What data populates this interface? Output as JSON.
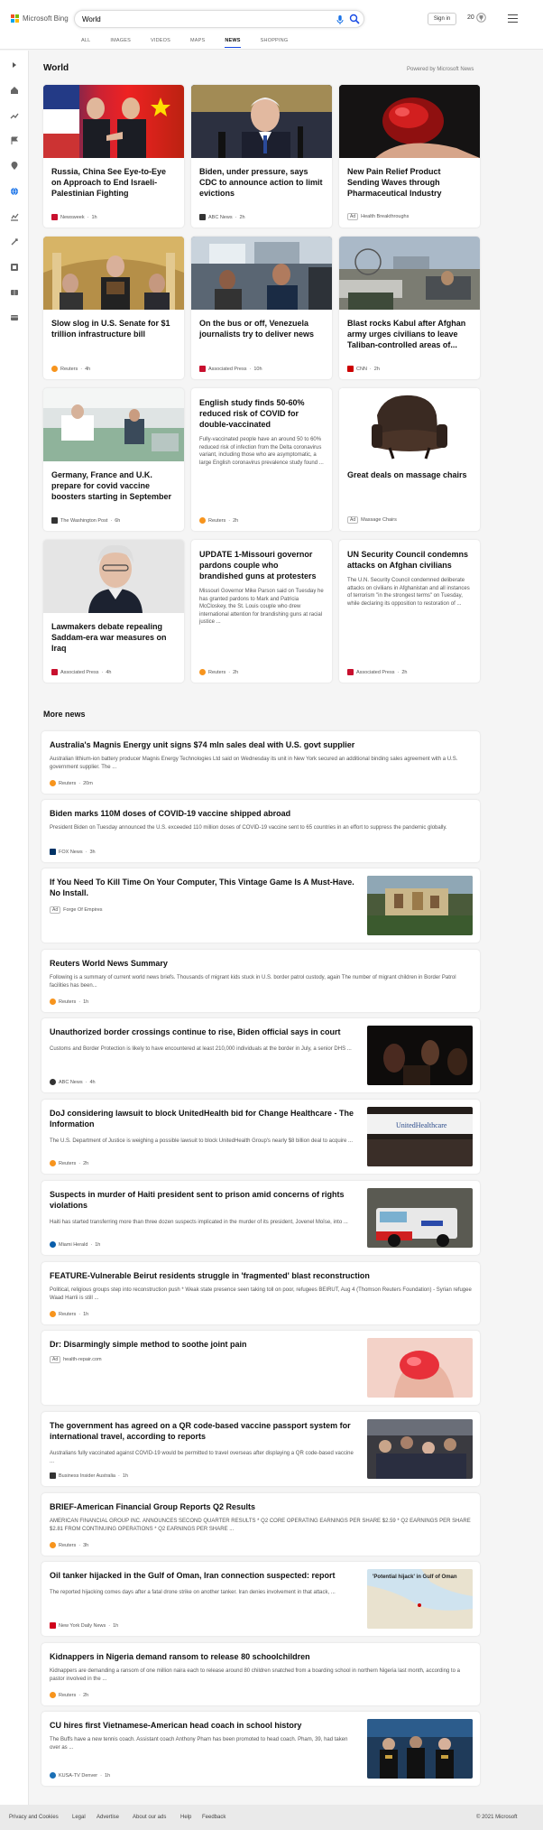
{
  "header": {
    "logo_text": "Microsoft Bing",
    "search_value": "World",
    "signin": "Sign in",
    "rewards_count": "20"
  },
  "nav": [
    "ALL",
    "IMAGES",
    "VIDEOS",
    "MAPS",
    "NEWS",
    "SHOPPING"
  ],
  "section": {
    "title": "World",
    "powered": "Powered by Microsoft News"
  },
  "cards": [
    {
      "title": "Russia, China See Eye-to-Eye on Approach to End Israeli-Palestinian Fighting",
      "source": "Newsweek",
      "time": "1h",
      "color": "#c8102e",
      "ad": false
    },
    {
      "title": "Biden, under pressure, says CDC to announce action to limit evictions",
      "source": "ABC News",
      "time": "2h",
      "color": "#333",
      "ad": false
    },
    {
      "title": "New Pain Relief Product Sending Waves through Pharmaceutical Industry",
      "source": "Health Breakthroughs",
      "time": "",
      "color": "",
      "ad": true
    },
    {
      "title": "Slow slog in U.S. Senate for $1 trillion infrastructure bill",
      "source": "Reuters",
      "time": "4h",
      "color": "#f7941d",
      "ad": false
    },
    {
      "title": "On the bus or off, Venezuela journalists try to deliver news",
      "source": "Associated Press",
      "time": "10h",
      "color": "#c8102e",
      "ad": false
    },
    {
      "title": "Blast rocks Kabul after Afghan army urges civilians to leave Taliban-controlled areas of...",
      "source": "CNN",
      "time": "2h",
      "color": "#cc0000",
      "ad": false
    },
    {
      "title": "Germany, France and U.K. prepare for covid vaccine boosters starting in September",
      "source": "The Washington Post",
      "time": "6h",
      "color": "#333",
      "ad": false
    },
    {
      "title": "English study finds 50-60% reduced risk of COVID for double-vaccinated",
      "desc": "Fully-vaccinated people have an around 50 to 60% reduced risk of infection from the Delta coronavirus variant, including those who are asymptomatic, a large English coronavirus prevalence study found ...",
      "source": "Reuters",
      "time": "2h",
      "color": "#f7941d",
      "ad": false
    },
    {
      "title": "Great deals on massage chairs",
      "source": "Massage Chairs",
      "time": "",
      "color": "",
      "ad": true
    },
    {
      "title": "Lawmakers debate repealing Saddam-era war measures on Iraq",
      "source": "Associated Press",
      "time": "4h",
      "color": "#c8102e",
      "ad": false
    },
    {
      "title": "UPDATE 1-Missouri governor pardons couple who brandished guns at protesters",
      "desc": "Missouri Governor Mike Parson said on Tuesday he has granted pardons to Mark and Patricia McCloskey, the St. Louis couple who drew international attention for brandishing guns at racial justice ...",
      "source": "Reuters",
      "time": "2h",
      "color": "#f7941d",
      "ad": false
    },
    {
      "title": "UN Security Council condemns attacks on Afghan civilians",
      "desc": "The U.N. Security Council condemned deliberate attacks on civilians in Afghanistan and all instances of terrorism \"in the strongest terms\" on Tuesday, while declaring its opposition to restoration of ...",
      "source": "Associated Press",
      "time": "2h",
      "color": "#c8102e",
      "ad": false
    }
  ],
  "more_title": "More news",
  "more": [
    {
      "title": "Australia's Magnis Energy unit signs $74 mln sales deal with U.S. govt supplier",
      "desc": "Australian lithium-ion battery producer Magnis Energy Technologies Ltd said on Wednesday its unit in New York secured an additional binding sales agreement with a U.S. government supplier. The ...",
      "source": "Reuters",
      "time": "20m",
      "color": "#f7941d",
      "ad": false
    },
    {
      "title": "Biden marks 110M doses of COVID-19 vaccine shipped abroad",
      "desc": "President Biden on Tuesday announced the U.S. exceeded 110 million doses of COVID-19 vaccine sent to 65 countries in an effort to suppress the pandemic globally.",
      "source": "FOX News",
      "time": "3h",
      "color": "#003366",
      "ad": false
    },
    {
      "title": "If You Need To Kill Time On Your Computer, This Vintage Game Is A Must-Have. No Install.",
      "desc": "",
      "source": "Forge Of Empires",
      "time": "",
      "color": "",
      "ad": true
    },
    {
      "title": "Reuters World News Summary",
      "desc": "Following is a summary of current world news briefs. Thousands of migrant kids stuck in U.S. border patrol custody, again The number of migrant children in Border Patrol facilities has been...",
      "source": "Reuters",
      "time": "1h",
      "color": "#f7941d",
      "ad": false
    },
    {
      "title": "Unauthorized border crossings continue to rise, Biden official says in court",
      "desc": "Customs and Border Protection is likely to have encountered at least 210,000 individuals at the border in July, a senior DHS ...",
      "source": "ABC News",
      "time": "4h",
      "color": "#333",
      "ad": false
    },
    {
      "title": "DoJ considering lawsuit to block UnitedHealth bid for Change Healthcare - The Information",
      "desc": "The U.S. Department of Justice is weighing a possible lawsuit to block UnitedHealth Group's nearly $8 billion deal to acquire ...",
      "source": "Reuters",
      "time": "2h",
      "color": "#f7941d",
      "ad": false
    },
    {
      "title": "Suspects in murder of Haiti president sent to prison amid concerns of rights violations",
      "desc": "Haiti has started transferring more than three dozen suspects implicated in the murder of its president, Jovenel Moïse, into ...",
      "source": "Miami Herald",
      "time": "1h",
      "color": "#0a5eab",
      "ad": false
    },
    {
      "title": "FEATURE-Vulnerable Beirut residents struggle in 'fragmented' blast reconstruction",
      "desc": "Political, religious groups step into reconstruction push * Weak state presence seen taking toll on poor, refugees BEIRUT, Aug 4 (Thomson Reuters Foundation) - Syrian refugee Waad Harrii is still ...",
      "source": "Reuters",
      "time": "1h",
      "color": "#f7941d",
      "ad": false
    },
    {
      "title": "Dr: Disarmingly simple method to soothe joint pain",
      "desc": "",
      "source": "health-repair.com",
      "time": "",
      "color": "",
      "ad": true
    },
    {
      "title": "The government has agreed on a QR code-based vaccine passport system for international travel, according to reports",
      "desc": "Australians fully vaccinated against COVID-19 would be permitted to travel overseas after displaying a QR code-based vaccine ...",
      "source": "Business Insider Australia",
      "time": "1h",
      "color": "#333",
      "ad": false
    },
    {
      "title": "BRIEF-American Financial Group Reports Q2 Results",
      "desc": "AMERICAN FINANCIAL GROUP INC. ANNOUNCES SECOND QUARTER RESULTS * Q2 CORE OPERATING EARNINGS PER SHARE $2.59 * Q2 EARNINGS PER SHARE $2.81 FROM CONTINUING OPERATIONS * Q2 EARNINGS PER SHARE ...",
      "source": "Reuters",
      "time": "3h",
      "color": "#f7941d",
      "ad": false
    },
    {
      "title": "Oil tanker hijacked in the Gulf of Oman, Iran connection suspected: report",
      "desc": "The reported hijacking comes days after a fatal drone strike on another tanker. Iran denies involvement in that attack, ...",
      "source": "New York Daily News",
      "time": "1h",
      "color": "#d0021b",
      "ad": false
    },
    {
      "title": "Kidnappers in Nigeria demand ransom to release 80 schoolchildren",
      "desc": "Kidnappers are demanding a ransom of one million naira each to release around 80 children snatched from a boarding school in northern Nigeria last month, according to a pastor involved in the ...",
      "source": "Reuters",
      "time": "2h",
      "color": "#f7941d",
      "ad": false
    },
    {
      "title": "CU hires first Vietnamese-American head coach in school history",
      "desc": "The Buffs have a new tennis coach. Assistant coach Anthony Pham has been promoted to head coach. Pham, 39, had taken over as ...",
      "source": "KUSA-TV Denver",
      "time": "1h",
      "color": "#1a6fb5",
      "ad": false
    }
  ],
  "thumb_caption": {
    "united": "UnitedHealthcare",
    "oman": "'Potential hijack' in Gulf of Oman"
  },
  "footer": [
    "Privacy and Cookies",
    "Legal",
    "Advertise",
    "About our ads",
    "Help",
    "Feedback"
  ],
  "copyright": "© 2021 Microsoft"
}
